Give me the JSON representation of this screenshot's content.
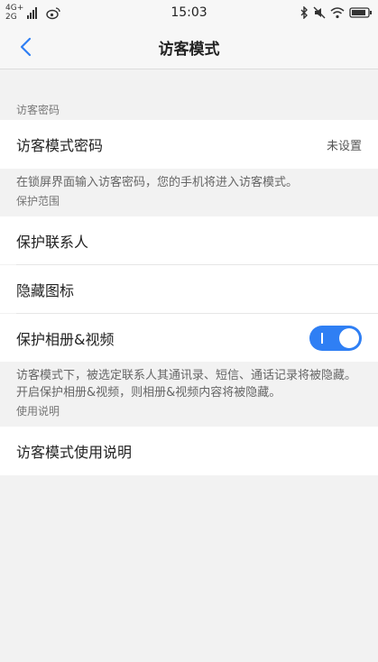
{
  "status_bar": {
    "network_top": "4G+",
    "network_bottom": "2G",
    "time": "15:03",
    "icons": [
      "signal-icon",
      "weibo-icon",
      "bluetooth-icon",
      "mute-icon",
      "wifi-icon",
      "battery-icon"
    ]
  },
  "header": {
    "title": "访客模式",
    "back_icon": "chevron-left-icon"
  },
  "sections": {
    "password": {
      "label": "访客密码",
      "row_label": "访客模式密码",
      "row_value": "未设置",
      "description": "在锁屏界面输入访客密码，您的手机将进入访客模式。"
    },
    "protection": {
      "label": "保护范围",
      "items": [
        "保护联系人",
        "隐藏图标",
        "保护相册&视频"
      ],
      "toggle_on": true,
      "description": "访客模式下，被选定联系人其通讯录、短信、通话记录将被隐藏。开启保护相册&视频，则相册&视频内容将被隐藏。"
    },
    "usage": {
      "label": "使用说明",
      "row_label": "访客模式使用说明"
    }
  },
  "colors": {
    "accent": "#2f7ff4",
    "background": "#f2f2f2"
  }
}
